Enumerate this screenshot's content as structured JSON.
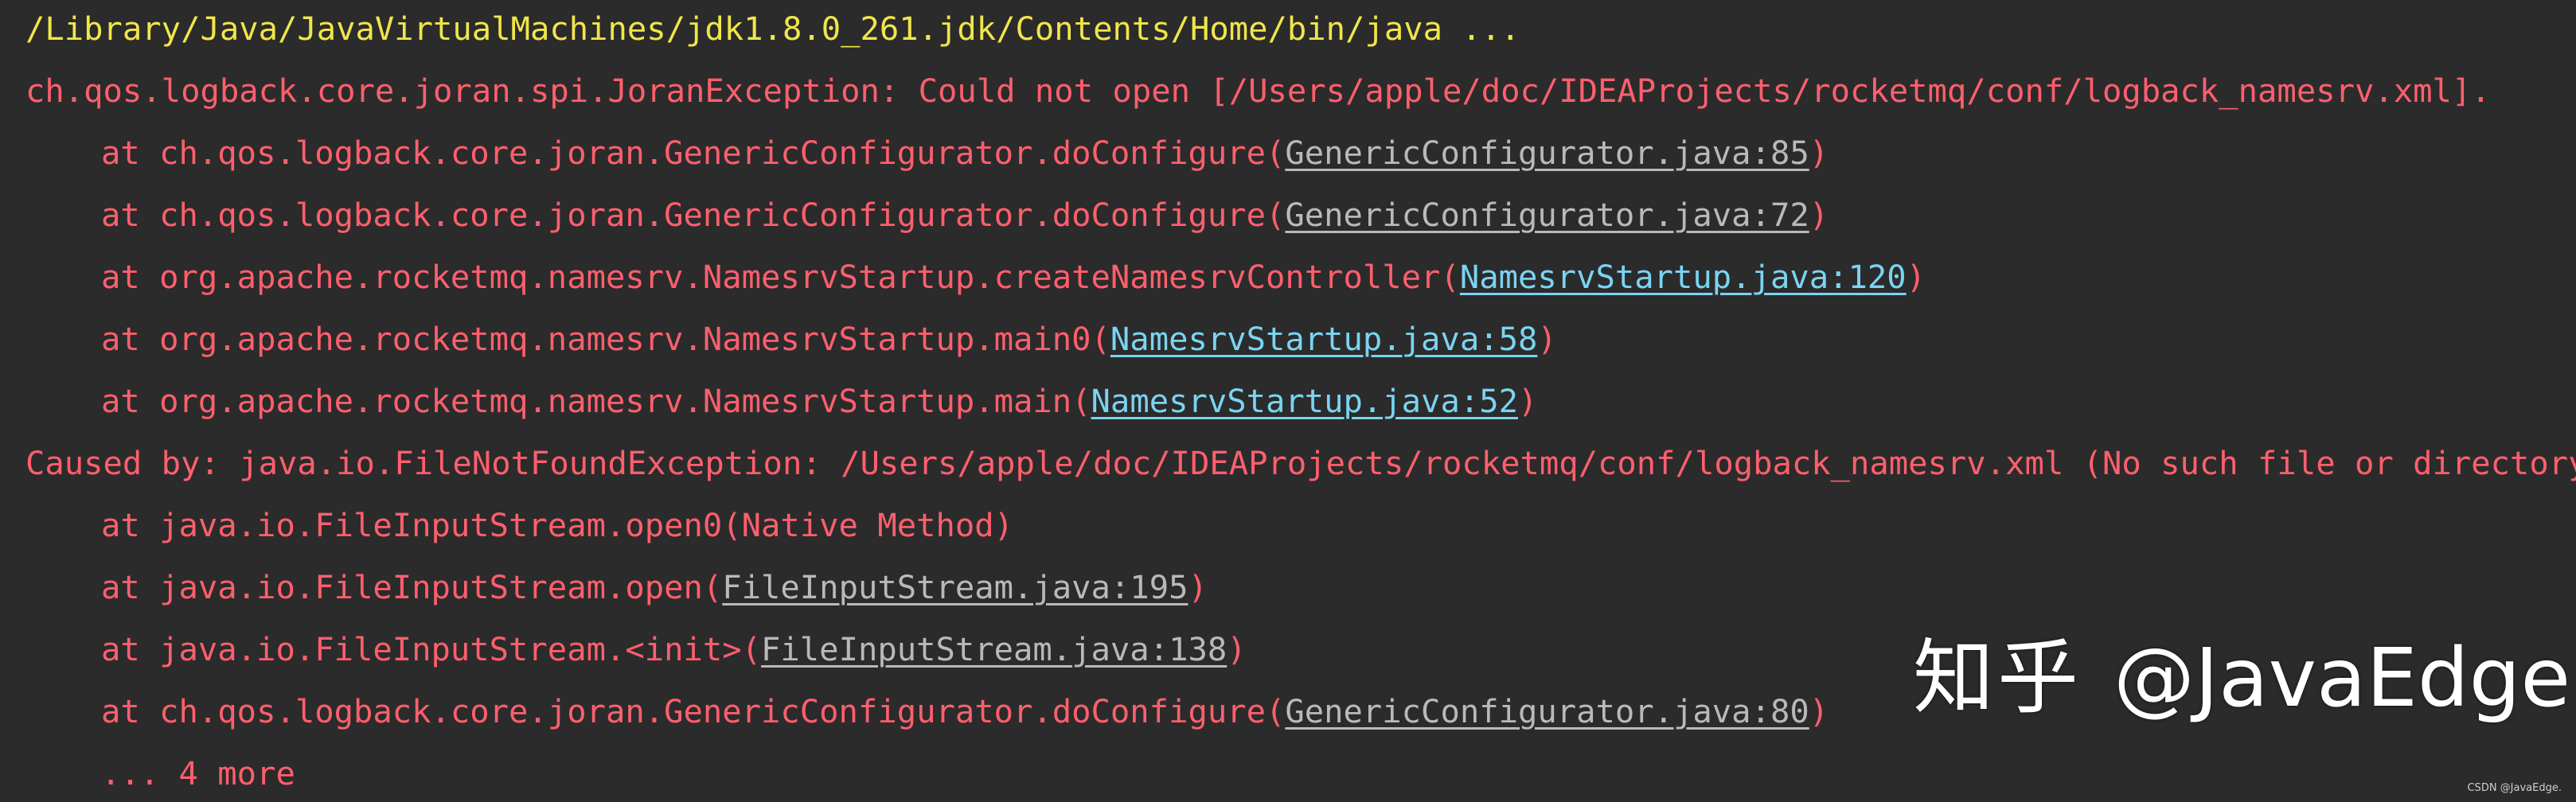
{
  "console": {
    "command": "/Library/Java/JavaVirtualMachines/jdk1.8.0_261.jdk/Contents/Home/bin/java ...",
    "exception": "ch.qos.logback.core.joran.spi.JoranException: Could not open [/Users/apple/doc/IDEAProjects/rocketmq/conf/logback_namesrv.xml].",
    "frames": [
      {
        "text": "at ch.qos.logback.core.joran.GenericConfigurator.doConfigure(",
        "link": "GenericConfigurator.java:85",
        "suffix": ")"
      },
      {
        "text": "at ch.qos.logback.core.joran.GenericConfigurator.doConfigure(",
        "link": "GenericConfigurator.java:72",
        "suffix": ")"
      },
      {
        "text": "at org.apache.rocketmq.namesrv.NamesrvStartup.createNamesrvController(",
        "link": "NamesrvStartup.java:120",
        "suffix": ")"
      },
      {
        "text": "at org.apache.rocketmq.namesrv.NamesrvStartup.main0(",
        "link": "NamesrvStartup.java:58",
        "suffix": ")"
      },
      {
        "text": "at org.apache.rocketmq.namesrv.NamesrvStartup.main(",
        "link": "NamesrvStartup.java:52",
        "suffix": ")"
      }
    ],
    "caused_by": "Caused by: java.io.FileNotFoundException: /Users/apple/doc/IDEAProjects/rocketmq/conf/logback_namesrv.xml (No such file or directory)",
    "cause_frames": [
      {
        "text": "at java.io.FileInputStream.open0(Native Method)"
      },
      {
        "text": "at java.io.FileInputStream.open(",
        "link": "FileInputStream.java:195",
        "suffix": ")"
      },
      {
        "text": "at java.io.FileInputStream.<init>(",
        "link": "FileInputStream.java:138",
        "suffix": ")"
      },
      {
        "text": "at ch.qos.logback.core.joran.GenericConfigurator.doConfigure(",
        "link": "GenericConfigurator.java:80",
        "suffix": ")"
      }
    ],
    "more": "... 4 more"
  },
  "watermark": {
    "logo": "知乎",
    "handle": "@JavaEdge"
  },
  "credit": "CSDN @JavaEdge.",
  "colors": {
    "background": "#2b2b2b",
    "command": "#f0e64a",
    "error": "#ff5f6d",
    "link_gray": "#b9b9b9",
    "link_cyan": "#7ad4f2"
  }
}
